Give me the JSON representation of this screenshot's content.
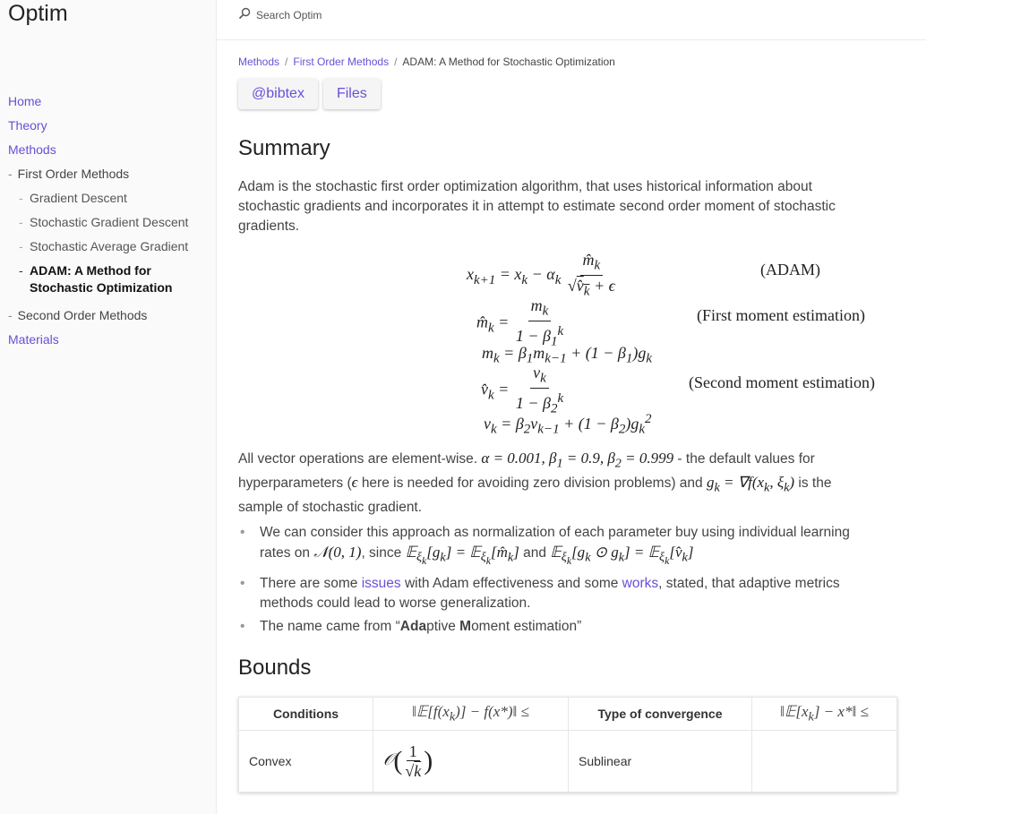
{
  "site": {
    "title": "Optim"
  },
  "search": {
    "placeholder": "Search Optim",
    "icon": "search-icon"
  },
  "sidebar": {
    "home": "Home",
    "theory": "Theory",
    "methods": "Methods",
    "first_order": "First Order Methods",
    "sub_items": [
      "Gradient Descent",
      "Stochastic Gradient Descent",
      "Stochastic Average Gradient",
      "ADAM: A Method for Stochastic Optimization"
    ],
    "second_order": "Second Order Methods",
    "materials": "Materials",
    "dash": "-"
  },
  "breadcrumb": {
    "items": [
      "Methods",
      "First Order Methods",
      "ADAM: A Method for Stochastic Optimization"
    ],
    "sep": "/"
  },
  "buttons": {
    "bibtex": "@bibtex",
    "files": "Files"
  },
  "summary": {
    "heading": "Summary",
    "intro": "Adam is the stochastic first order optimization algorithm, that uses historical information about stochastic gradients and incorporates it in attempt to estimate second order moment of stochastic gradients.",
    "tags": {
      "adam": "(ADAM)",
      "first": "(First moment estimation)",
      "second": "(Second moment estimation)"
    },
    "p2_a": "All vector operations are element-wise.",
    "p2_b": "- the default values for hyperparameters (",
    "p2_c": "here is needed for avoiding zero division problems) and",
    "p2_d": "is the sample of stochastic gradient.",
    "bullet1_a": "We can consider this approach as normalization of each parameter buy using individual learning rates on",
    "bullet1_b": ", since",
    "bullet1_c": "and",
    "bullet2_a": "There are some",
    "bullet2_link1": "issues",
    "bullet2_b": "with Adam effectiveness and some",
    "bullet2_link2": "works",
    "bullet2_c": ", stated, that adaptive metrics methods could lead to worse generalization.",
    "bullet3_a": "The name came from “",
    "bullet3_b1": "Ada",
    "bullet3_c1": "ptive ",
    "bullet3_b2": "M",
    "bullet3_c2": "oment estimation”"
  },
  "bounds": {
    "heading": "Bounds",
    "headers": [
      "Conditions",
      "Type of convergence"
    ],
    "rows": [
      {
        "condition": "Convex",
        "type": "Sublinear"
      }
    ]
  }
}
